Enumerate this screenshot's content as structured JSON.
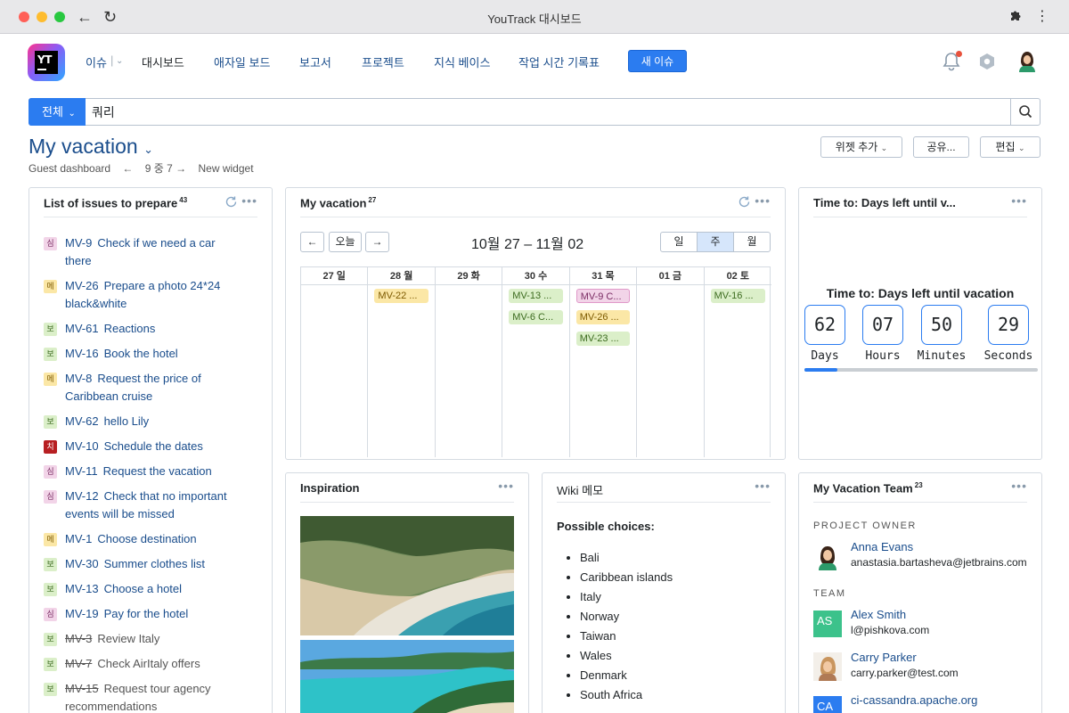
{
  "browser": {
    "title": "YouTrack 대시보드"
  },
  "nav": {
    "issues": "이슈",
    "dashboards": "대시보드",
    "agile": "애자일 보드",
    "reports": "보고서",
    "projects": "프로젝트",
    "kb": "지식 베이스",
    "timesheets": "작업 시간 기록표",
    "new_issue": "새 이슈"
  },
  "search": {
    "scope": "전체",
    "value": "쿼리"
  },
  "dashboard": {
    "title": "My vacation",
    "guest": "Guest dashboard",
    "pager": "9 중 7",
    "new_widget": "New widget",
    "add_widget": "위젯 추가",
    "share": "공유...",
    "edit": "편집"
  },
  "issues_widget": {
    "title": "List of issues to prepare",
    "count": "43",
    "items": [
      {
        "tag": "심",
        "id": "MV-9",
        "summary": "Check if we need a car",
        "summary2": "there",
        "style": "t1"
      },
      {
        "tag": "메",
        "id": "MV-26",
        "summary": "Prepare a photo 24*24",
        "summary2": "black&white",
        "style": "t2"
      },
      {
        "tag": "보",
        "id": "MV-61",
        "summary": "Reactions",
        "summary2": "",
        "style": "t3"
      },
      {
        "tag": "보",
        "id": "MV-16",
        "summary": "Book the hotel",
        "summary2": "",
        "style": "t3"
      },
      {
        "tag": "메",
        "id": "MV-8",
        "summary": "Request the price of",
        "summary2": "Caribbean cruise",
        "style": "t2"
      },
      {
        "tag": "보",
        "id": "MV-62",
        "summary": "hello Lily",
        "summary2": "",
        "style": "t3"
      },
      {
        "tag": "치",
        "id": "MV-10",
        "summary": "Schedule the dates",
        "summary2": "",
        "style": "t4"
      },
      {
        "tag": "심",
        "id": "MV-11",
        "summary": "Request the vacation",
        "summary2": "",
        "style": "t1"
      },
      {
        "tag": "심",
        "id": "MV-12",
        "summary": "Check that no important",
        "summary2": "events will be missed",
        "style": "t1"
      },
      {
        "tag": "메",
        "id": "MV-1",
        "summary": "Choose destination",
        "summary2": "",
        "style": "t2"
      },
      {
        "tag": "보",
        "id": "MV-30",
        "summary": "Summer clothes list",
        "summary2": "",
        "style": "t3"
      },
      {
        "tag": "보",
        "id": "MV-13",
        "summary": "Choose a hotel",
        "summary2": "",
        "style": "t3"
      },
      {
        "tag": "심",
        "id": "MV-19",
        "summary": "Pay for the hotel",
        "summary2": "",
        "style": "t1"
      },
      {
        "tag": "보",
        "id": "MV-3",
        "summary": "Review Italy",
        "summary2": "",
        "style": "t3",
        "done": true
      },
      {
        "tag": "보",
        "id": "MV-7",
        "summary": "Check AirItaly offers",
        "summary2": "",
        "style": "t3",
        "done": true
      },
      {
        "tag": "보",
        "id": "MV-15",
        "summary": "Request tour agency",
        "summary2": "recommendations",
        "style": "t3",
        "done": true
      }
    ]
  },
  "calendar_widget": {
    "title": "My vacation",
    "count": "27",
    "today": "오늘",
    "range": "10월 27 – 11월 02",
    "views": [
      "일",
      "주",
      "월"
    ],
    "days": [
      "27 일",
      "28 월",
      "29 화",
      "30 수",
      "31 목",
      "01 금",
      "02 토"
    ],
    "events": [
      {
        "day": 1,
        "row": 0,
        "label": "MV-22 ...",
        "style": "y"
      },
      {
        "day": 3,
        "row": 0,
        "label": "MV-13 ...",
        "style": "g"
      },
      {
        "day": 3,
        "row": 1,
        "label": "MV-6 C...",
        "style": "g"
      },
      {
        "day": 4,
        "row": 0,
        "label": "MV-9 C...",
        "style": "p"
      },
      {
        "day": 4,
        "row": 1,
        "label": "MV-26 ...",
        "style": "y"
      },
      {
        "day": 4,
        "row": 2,
        "label": "MV-23 ...",
        "style": "g"
      },
      {
        "day": 6,
        "row": 0,
        "label": "MV-16 ...",
        "style": "g"
      }
    ]
  },
  "countdown_widget": {
    "title": "Time to: Days left until v...",
    "heading": "Time to: Days left until vacation",
    "units": [
      {
        "value": "62",
        "label": "Days"
      },
      {
        "value": "07",
        "label": "Hours"
      },
      {
        "value": "50",
        "label": "Minutes"
      },
      {
        "value": "29",
        "label": "Seconds"
      }
    ],
    "progress": 0.14
  },
  "inspiration_widget": {
    "title": "Inspiration"
  },
  "wiki_widget": {
    "title": "Wiki 메모",
    "heading": "Possible choices:",
    "items": [
      "Bali",
      "Caribbean islands",
      "Italy",
      "Norway",
      "Taiwan",
      "Wales",
      "Denmark",
      "South Africa"
    ]
  },
  "team_widget": {
    "title": "My Vacation Team",
    "count": "23",
    "owner_label": "PROJECT OWNER",
    "team_label": "TEAM",
    "owner": {
      "name": "Anna Evans",
      "email": "anastasia.bartasheva@jetbrains.com"
    },
    "members": [
      {
        "name": "Alex Smith",
        "email": "l@pishkova.com",
        "initials": "AS",
        "color": "#3cc28b"
      },
      {
        "name": "Carry Parker",
        "email": "carry.parker@test.com",
        "initials": "",
        "color": ""
      },
      {
        "name": "ci-cassandra.apache.org",
        "email": "",
        "initials": "CA",
        "color": "#2b7cf0"
      }
    ]
  },
  "colors": {
    "accent": "#2b7cf0",
    "link": "#1a4d8c"
  }
}
